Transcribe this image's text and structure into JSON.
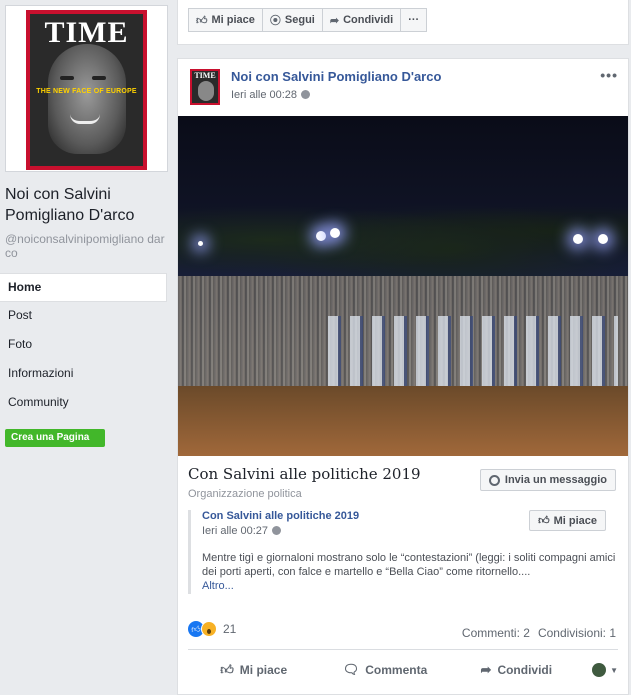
{
  "sidebar": {
    "cover_masthead": "TIME",
    "cover_tagline": "THE NEW FACE OF EUROPE",
    "page_name": "Noi con Salvini Pomigliano D'arco",
    "page_handle": "@noiconsalvinipomigliano darco",
    "nav": [
      {
        "label": "Home",
        "active": true
      },
      {
        "label": "Post"
      },
      {
        "label": "Foto"
      },
      {
        "label": "Informazioni"
      },
      {
        "label": "Community"
      }
    ],
    "create_page_label": "Crea una Pagina"
  },
  "top_actions": {
    "like_label": "Mi piace",
    "follow_label": "Segui",
    "share_label": "Condividi",
    "more_label": "···"
  },
  "post": {
    "author": "Noi con Salvini Pomigliano D'arco",
    "avatar_text": "TIME",
    "time": "Ieri alle 00:28",
    "more_label": "•••",
    "link_title": "Con Salvini alle politiche 2019",
    "link_subtitle": "Organizzazione politica",
    "message_button": "Invia un messaggio",
    "quote": {
      "title": "Con Salvini alle politiche 2019",
      "time": "Ieri alle 00:27",
      "like_button": "Mi piace",
      "body": "Mentre tigì e giornaloni mostrano solo le “contestazioni” (leggi: i soliti compagni amici dei porti aperti, con falce e martello e “Bella Ciao” come ritornello....",
      "more_link": "Altro..."
    },
    "reactions_count": "21",
    "comments": "Commenti: 2",
    "shares": "Condivisioni: 1",
    "actions": {
      "like": "Mi piace",
      "comment": "Commenta",
      "share": "Condividi"
    }
  },
  "colors": {
    "link_blue": "#365899",
    "create_green": "#42b72a",
    "like_blue": "#1877f2",
    "time_red": "#c8102e"
  }
}
